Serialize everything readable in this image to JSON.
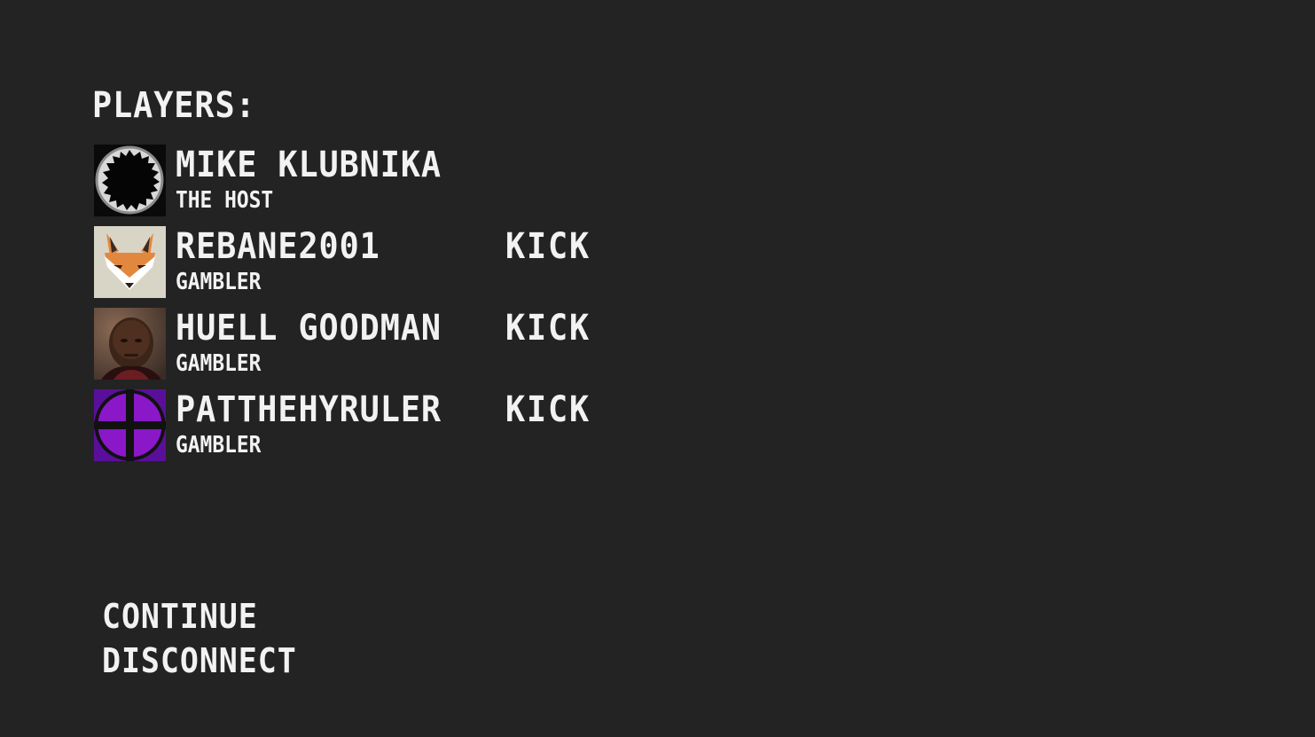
{
  "lobby": {
    "heading": "PLAYERS:",
    "players": [
      {
        "name": "MIKE KLUBNIKA",
        "role": "THE HOST",
        "avatar": "black-hole-avatar",
        "kick": ""
      },
      {
        "name": "REBANE2001",
        "role": "GAMBLER",
        "avatar": "fox-avatar",
        "kick": "KICK"
      },
      {
        "name": "HUELL GOODMAN",
        "role": "GAMBLER",
        "avatar": "man-portrait-avatar",
        "kick": "KICK"
      },
      {
        "name": "PATTHEHYRULER",
        "role": "GAMBLER",
        "avatar": "purple-crosshair-avatar",
        "kick": "KICK"
      }
    ]
  },
  "menu": {
    "continue_label": "CONTINUE",
    "disconnect_label": "DISCONNECT"
  },
  "colors": {
    "background": "#232323",
    "text": "#f2f2f2"
  }
}
